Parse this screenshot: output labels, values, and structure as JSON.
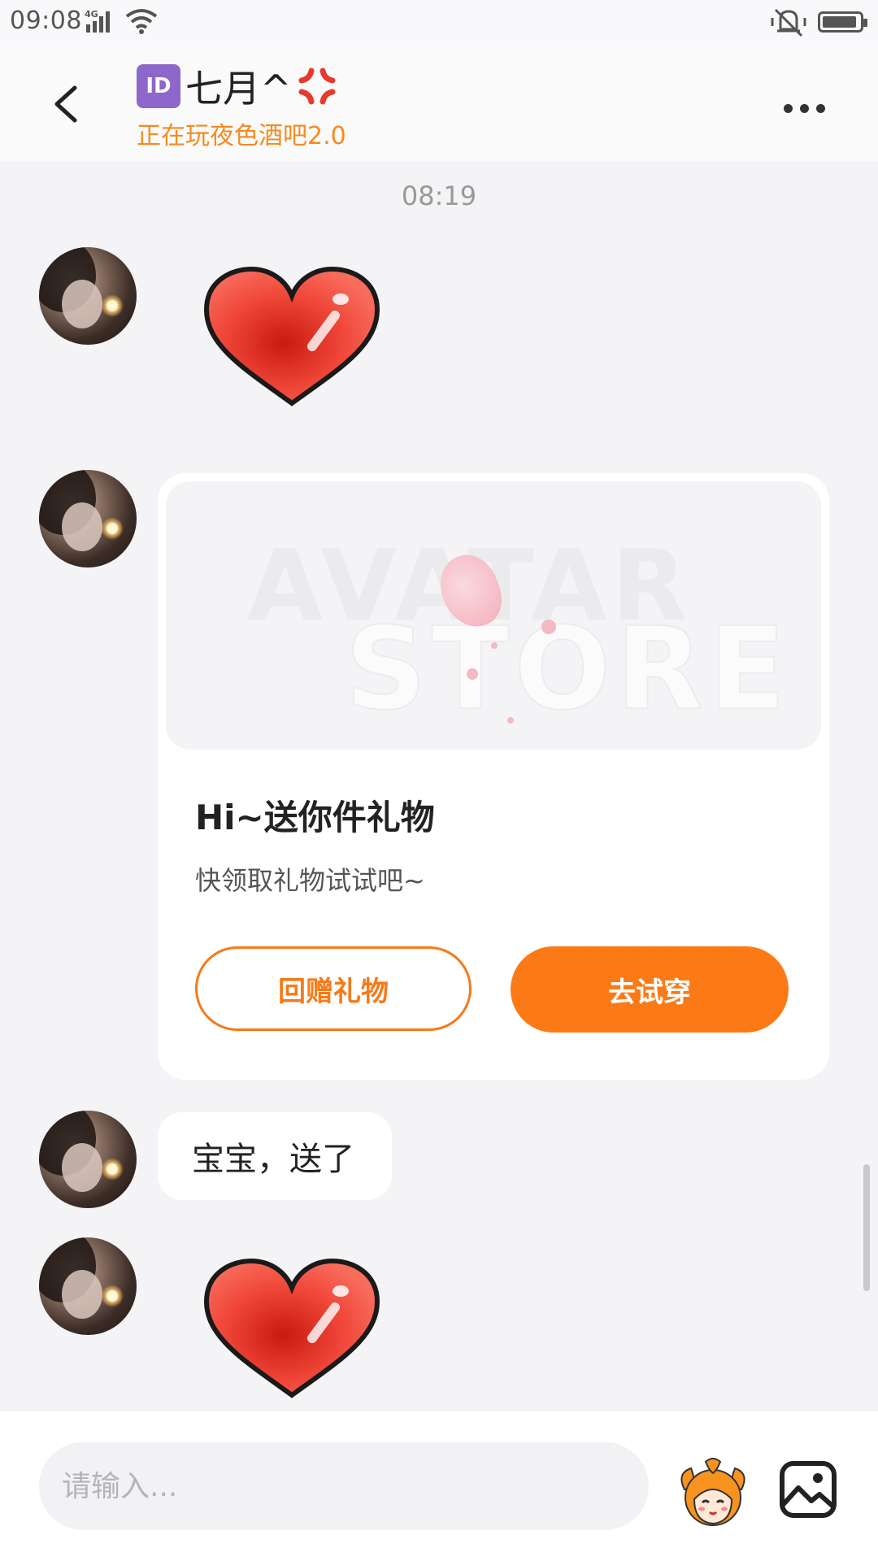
{
  "status_bar": {
    "time": "09:08",
    "network": "4G",
    "icons": [
      "signal-icon",
      "wifi-icon",
      "vibrate-icon",
      "battery-icon"
    ]
  },
  "header": {
    "id_badge": "ID",
    "title": "七月^",
    "subtitle": "正在玩夜色酒吧2.0",
    "icons": [
      "back-icon",
      "anger-emoji-icon",
      "more-icon"
    ]
  },
  "chat": {
    "timestamp": "08:19",
    "messages": [
      {
        "type": "sticker",
        "sticker": "heart-sticker"
      },
      {
        "type": "gift-card",
        "banner_text_1": "AVATAR",
        "banner_text_2": "STORE",
        "title": "Hi~送你件礼物",
        "description": "快领取礼物试试吧~",
        "return_gift_label": "回赠礼物",
        "try_on_label": "去试穿"
      },
      {
        "type": "text",
        "text": "宝宝，送了"
      },
      {
        "type": "sticker",
        "sticker": "heart-sticker"
      }
    ]
  },
  "input_bar": {
    "placeholder": "请输入...",
    "value": "",
    "icons": [
      "mascot-icon",
      "image-icon"
    ]
  },
  "colors": {
    "accent": "#fb7a16",
    "subtitle": "#f58a1f",
    "background": "#f4f4f7",
    "id_badge": "#8d67c9"
  }
}
